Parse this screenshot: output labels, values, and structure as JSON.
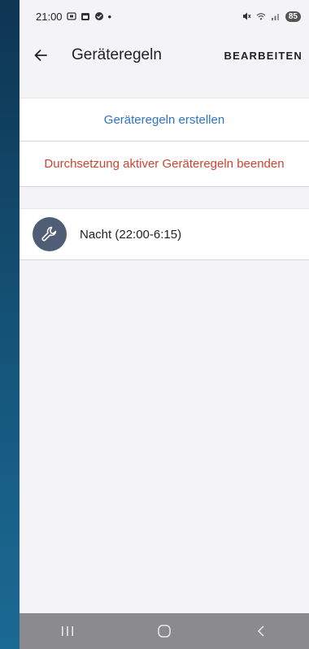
{
  "status_bar": {
    "time": "21:00",
    "dot": "•",
    "battery": "85"
  },
  "app_bar": {
    "title": "Geräteregeln",
    "edit_label": "BEARBEITEN"
  },
  "actions": {
    "create_label": "Geräteregeln erstellen",
    "stop_label": "Durchsetzung aktiver Geräteregeln beenden"
  },
  "rules": [
    {
      "label": "Nacht (22:00-6:15)",
      "icon": "wrench-icon"
    }
  ],
  "colors": {
    "primary_link": "#2f74c0",
    "danger": "#c84430",
    "rule_icon_bg": "#4f5d75"
  }
}
